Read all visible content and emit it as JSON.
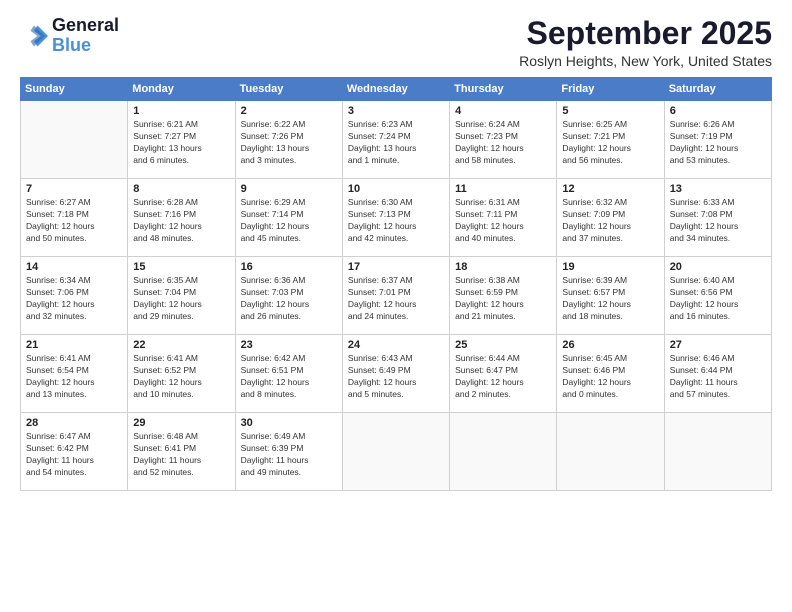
{
  "logo": {
    "line1": "General",
    "line2": "Blue"
  },
  "title": "September 2025",
  "location": "Roslyn Heights, New York, United States",
  "weekdays": [
    "Sunday",
    "Monday",
    "Tuesday",
    "Wednesday",
    "Thursday",
    "Friday",
    "Saturday"
  ],
  "weeks": [
    [
      {
        "day": "",
        "info": ""
      },
      {
        "day": "1",
        "info": "Sunrise: 6:21 AM\nSunset: 7:27 PM\nDaylight: 13 hours\nand 6 minutes."
      },
      {
        "day": "2",
        "info": "Sunrise: 6:22 AM\nSunset: 7:26 PM\nDaylight: 13 hours\nand 3 minutes."
      },
      {
        "day": "3",
        "info": "Sunrise: 6:23 AM\nSunset: 7:24 PM\nDaylight: 13 hours\nand 1 minute."
      },
      {
        "day": "4",
        "info": "Sunrise: 6:24 AM\nSunset: 7:23 PM\nDaylight: 12 hours\nand 58 minutes."
      },
      {
        "day": "5",
        "info": "Sunrise: 6:25 AM\nSunset: 7:21 PM\nDaylight: 12 hours\nand 56 minutes."
      },
      {
        "day": "6",
        "info": "Sunrise: 6:26 AM\nSunset: 7:19 PM\nDaylight: 12 hours\nand 53 minutes."
      }
    ],
    [
      {
        "day": "7",
        "info": "Sunrise: 6:27 AM\nSunset: 7:18 PM\nDaylight: 12 hours\nand 50 minutes."
      },
      {
        "day": "8",
        "info": "Sunrise: 6:28 AM\nSunset: 7:16 PM\nDaylight: 12 hours\nand 48 minutes."
      },
      {
        "day": "9",
        "info": "Sunrise: 6:29 AM\nSunset: 7:14 PM\nDaylight: 12 hours\nand 45 minutes."
      },
      {
        "day": "10",
        "info": "Sunrise: 6:30 AM\nSunset: 7:13 PM\nDaylight: 12 hours\nand 42 minutes."
      },
      {
        "day": "11",
        "info": "Sunrise: 6:31 AM\nSunset: 7:11 PM\nDaylight: 12 hours\nand 40 minutes."
      },
      {
        "day": "12",
        "info": "Sunrise: 6:32 AM\nSunset: 7:09 PM\nDaylight: 12 hours\nand 37 minutes."
      },
      {
        "day": "13",
        "info": "Sunrise: 6:33 AM\nSunset: 7:08 PM\nDaylight: 12 hours\nand 34 minutes."
      }
    ],
    [
      {
        "day": "14",
        "info": "Sunrise: 6:34 AM\nSunset: 7:06 PM\nDaylight: 12 hours\nand 32 minutes."
      },
      {
        "day": "15",
        "info": "Sunrise: 6:35 AM\nSunset: 7:04 PM\nDaylight: 12 hours\nand 29 minutes."
      },
      {
        "day": "16",
        "info": "Sunrise: 6:36 AM\nSunset: 7:03 PM\nDaylight: 12 hours\nand 26 minutes."
      },
      {
        "day": "17",
        "info": "Sunrise: 6:37 AM\nSunset: 7:01 PM\nDaylight: 12 hours\nand 24 minutes."
      },
      {
        "day": "18",
        "info": "Sunrise: 6:38 AM\nSunset: 6:59 PM\nDaylight: 12 hours\nand 21 minutes."
      },
      {
        "day": "19",
        "info": "Sunrise: 6:39 AM\nSunset: 6:57 PM\nDaylight: 12 hours\nand 18 minutes."
      },
      {
        "day": "20",
        "info": "Sunrise: 6:40 AM\nSunset: 6:56 PM\nDaylight: 12 hours\nand 16 minutes."
      }
    ],
    [
      {
        "day": "21",
        "info": "Sunrise: 6:41 AM\nSunset: 6:54 PM\nDaylight: 12 hours\nand 13 minutes."
      },
      {
        "day": "22",
        "info": "Sunrise: 6:41 AM\nSunset: 6:52 PM\nDaylight: 12 hours\nand 10 minutes."
      },
      {
        "day": "23",
        "info": "Sunrise: 6:42 AM\nSunset: 6:51 PM\nDaylight: 12 hours\nand 8 minutes."
      },
      {
        "day": "24",
        "info": "Sunrise: 6:43 AM\nSunset: 6:49 PM\nDaylight: 12 hours\nand 5 minutes."
      },
      {
        "day": "25",
        "info": "Sunrise: 6:44 AM\nSunset: 6:47 PM\nDaylight: 12 hours\nand 2 minutes."
      },
      {
        "day": "26",
        "info": "Sunrise: 6:45 AM\nSunset: 6:46 PM\nDaylight: 12 hours\nand 0 minutes."
      },
      {
        "day": "27",
        "info": "Sunrise: 6:46 AM\nSunset: 6:44 PM\nDaylight: 11 hours\nand 57 minutes."
      }
    ],
    [
      {
        "day": "28",
        "info": "Sunrise: 6:47 AM\nSunset: 6:42 PM\nDaylight: 11 hours\nand 54 minutes."
      },
      {
        "day": "29",
        "info": "Sunrise: 6:48 AM\nSunset: 6:41 PM\nDaylight: 11 hours\nand 52 minutes."
      },
      {
        "day": "30",
        "info": "Sunrise: 6:49 AM\nSunset: 6:39 PM\nDaylight: 11 hours\nand 49 minutes."
      },
      {
        "day": "",
        "info": ""
      },
      {
        "day": "",
        "info": ""
      },
      {
        "day": "",
        "info": ""
      },
      {
        "day": "",
        "info": ""
      }
    ]
  ]
}
